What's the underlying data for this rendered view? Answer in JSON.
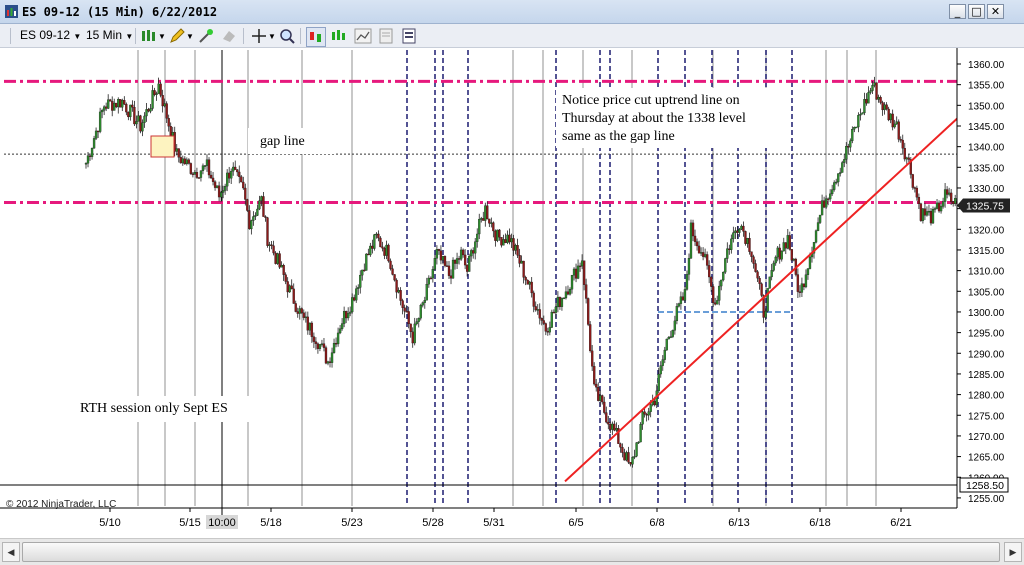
{
  "window": {
    "title": "ES 09-12 (15 Min)  6/22/2012",
    "minimize": "_",
    "maximize": "□",
    "close": "✕"
  },
  "toolbar": {
    "instrument": "ES 09-12",
    "interval": "15 Min"
  },
  "colors": {
    "candle_up": "#2e8b2e",
    "candle_down": "#8b1a1a",
    "magenta": "#e6197d",
    "trend": "#ee2222",
    "vline_dash": "#2a2a7a",
    "support": "#6a9ed8"
  },
  "chart_data": {
    "type": "candlestick",
    "x_tick_labels": [
      "5/10",
      "5/15",
      "5/18",
      "5/23",
      "5/28",
      "5/31",
      "6/5",
      "6/8",
      "6/13",
      "6/18",
      "6/21"
    ],
    "crosshair_label": "10:00",
    "ylim": [
      1254,
      1362
    ],
    "y_ticks": [
      1255,
      1260,
      1265,
      1270,
      1275,
      1280,
      1285,
      1290,
      1295,
      1300,
      1305,
      1310,
      1315,
      1320,
      1325,
      1330,
      1335,
      1340,
      1345,
      1350,
      1355,
      1360
    ],
    "y_tick_labels": [
      "1255.00",
      "1260.00",
      "1265.00",
      "1270.00",
      "1275.00",
      "1280.00",
      "1285.00",
      "1290.00",
      "1295.00",
      "1300.00",
      "1305.00",
      "1310.00",
      "1315.00",
      "1320.00",
      "1325.00",
      "1330.00",
      "1335.00",
      "1340.00",
      "1345.00",
      "1350.00",
      "1355.00",
      "1360.00"
    ],
    "price_label": "1325.75",
    "crosshair_price_label": "1258.50",
    "horizontal_lines": [
      {
        "price": 1355.8,
        "style": "dashdot",
        "color": "magenta"
      },
      {
        "price": 1326.5,
        "style": "dashdot",
        "color": "magenta"
      },
      {
        "price": 1338.2,
        "style": "dotted",
        "color": "black"
      },
      {
        "price": 1300,
        "style": "dashed",
        "color": "support",
        "from_day": 38,
        "to_day": 46
      }
    ],
    "trendline": {
      "from": {
        "day": 33.6,
        "price": 1259
      },
      "to": {
        "day": 59.2,
        "price": 1347
      }
    },
    "annotations": [
      {
        "text": "gap line"
      },
      {
        "text": "Notice price cut uptrend line on"
      },
      {
        "text": "Thursday at about the 1338 level"
      },
      {
        "text": "same as the gap line"
      },
      {
        "text": "RTH session only Sept ES"
      }
    ],
    "copyright": "© 2012 NinjaTrader, LLC",
    "series_path": [
      [
        0,
        1336,
        1342,
        1332
      ],
      [
        1.5,
        1350,
        1356,
        1346
      ],
      [
        3,
        1351,
        1356,
        1343
      ],
      [
        4.5,
        1345,
        1350,
        1338
      ],
      [
        6,
        1355,
        1358,
        1350
      ],
      [
        7.5,
        1338,
        1342,
        1334
      ],
      [
        9,
        1334,
        1337,
        1326
      ],
      [
        10,
        1335,
        1339,
        1329
      ],
      [
        11,
        1328,
        1333,
        1322
      ],
      [
        12,
        1335,
        1339,
        1329
      ],
      [
        13,
        1329,
        1333,
        1324
      ],
      [
        13.5,
        1322,
        1326,
        1319
      ],
      [
        14.5,
        1327,
        1331,
        1321
      ],
      [
        15,
        1318,
        1322,
        1312
      ],
      [
        16,
        1311,
        1316,
        1306
      ],
      [
        17,
        1304,
        1309,
        1299
      ],
      [
        18,
        1298,
        1304,
        1294
      ],
      [
        19,
        1294,
        1299,
        1289
      ],
      [
        20,
        1288,
        1292,
        1284
      ],
      [
        21,
        1297,
        1301,
        1292
      ],
      [
        22,
        1303,
        1307,
        1299
      ],
      [
        23,
        1312,
        1316,
        1307
      ],
      [
        24,
        1318,
        1321,
        1314
      ],
      [
        25,
        1314,
        1318,
        1309
      ],
      [
        26,
        1303,
        1308,
        1298
      ],
      [
        27,
        1294,
        1298,
        1289
      ],
      [
        28,
        1303,
        1308,
        1298
      ],
      [
        29,
        1314,
        1318,
        1309
      ],
      [
        30,
        1309,
        1314,
        1304
      ],
      [
        31,
        1314,
        1318,
        1309
      ],
      [
        31.5,
        1310,
        1316,
        1306
      ],
      [
        32,
        1316,
        1321,
        1312
      ],
      [
        33,
        1325,
        1327,
        1318
      ],
      [
        34,
        1318,
        1322,
        1313
      ],
      [
        35,
        1318,
        1322,
        1314
      ],
      [
        36,
        1311,
        1316,
        1306
      ],
      [
        37,
        1303,
        1307,
        1297
      ],
      [
        38,
        1296,
        1301,
        1292
      ],
      [
        39,
        1302,
        1306,
        1297
      ],
      [
        40,
        1307,
        1312,
        1303
      ],
      [
        41,
        1313,
        1316,
        1308
      ],
      [
        42,
        1281,
        1286,
        1276
      ],
      [
        43,
        1275,
        1280,
        1270
      ],
      [
        44,
        1269,
        1273,
        1264
      ],
      [
        45,
        1262,
        1266,
        1258
      ],
      [
        45.5,
        1268,
        1272,
        1262
      ],
      [
        46,
        1274,
        1278,
        1269
      ],
      [
        47,
        1279,
        1283,
        1274
      ],
      [
        48,
        1293,
        1296,
        1288
      ],
      [
        49,
        1301,
        1305,
        1297
      ],
      [
        49.5,
        1304,
        1308,
        1300
      ],
      [
        50,
        1320,
        1324,
        1316
      ],
      [
        51,
        1314,
        1318,
        1310
      ],
      [
        52,
        1302,
        1306,
        1298
      ],
      [
        53,
        1315,
        1320,
        1311
      ],
      [
        54,
        1322,
        1329,
        1317
      ],
      [
        55,
        1315,
        1320,
        1310
      ],
      [
        56,
        1300,
        1305,
        1297
      ],
      [
        57,
        1313,
        1318,
        1309
      ],
      [
        58,
        1318,
        1322,
        1313
      ],
      [
        59,
        1304,
        1309,
        1301
      ],
      [
        60,
        1316,
        1320,
        1311
      ],
      [
        61,
        1327,
        1331,
        1323
      ],
      [
        62,
        1333,
        1337,
        1328
      ],
      [
        63,
        1340,
        1344,
        1335
      ],
      [
        64,
        1348,
        1352,
        1344
      ],
      [
        65,
        1355,
        1358,
        1350
      ],
      [
        66,
        1349,
        1353,
        1344
      ],
      [
        67,
        1345,
        1350,
        1340
      ],
      [
        68,
        1336,
        1340,
        1331
      ],
      [
        69,
        1324,
        1329,
        1319
      ],
      [
        70,
        1323,
        1327,
        1318
      ],
      [
        71,
        1328,
        1331,
        1324
      ],
      [
        72,
        1326,
        1329,
        1323
      ]
    ]
  }
}
